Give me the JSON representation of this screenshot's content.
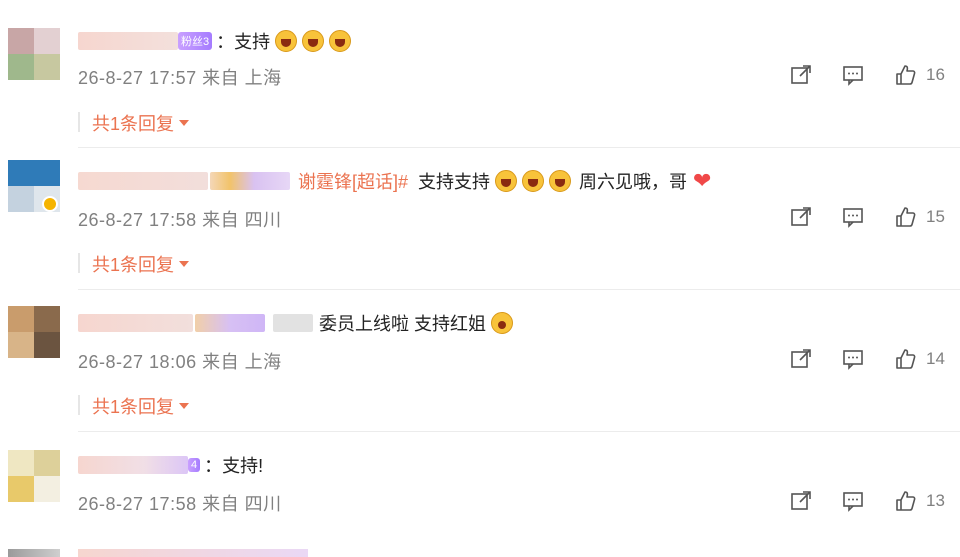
{
  "comments": [
    {
      "badge": "粉丝3",
      "text": "：支持",
      "emojis": 3,
      "time": "26-8-27 17:57 来自 上海",
      "likes": "16",
      "reply": "共1条回复"
    },
    {
      "topic": "谢霆锋[超话]#",
      "text": "支持支持",
      "text_after": "周六见哦，哥",
      "emojis": 3,
      "time": "26-8-27 17:58 来自 四川",
      "time_display": "26-8-27 17:58 来自 四川",
      "likes": "15",
      "reply": "共1条回复"
    },
    {
      "text": "委员上线啦 支持红姐",
      "time": "26-8-27 18:06 来自 上海",
      "likes": "14",
      "reply": "共1条回复"
    },
    {
      "badge": "4",
      "text": "：支持!",
      "time": "26-8-27 17:58 来自 四川",
      "likes": "13"
    }
  ],
  "colors": {
    "accent": "#eb7350",
    "meta": "#808080",
    "heart": "#f04848"
  },
  "icons": [
    "share-icon",
    "comment-icon",
    "like-icon",
    "heart-icon",
    "laugh-emoji",
    "wow-emoji",
    "verified-icon"
  ]
}
